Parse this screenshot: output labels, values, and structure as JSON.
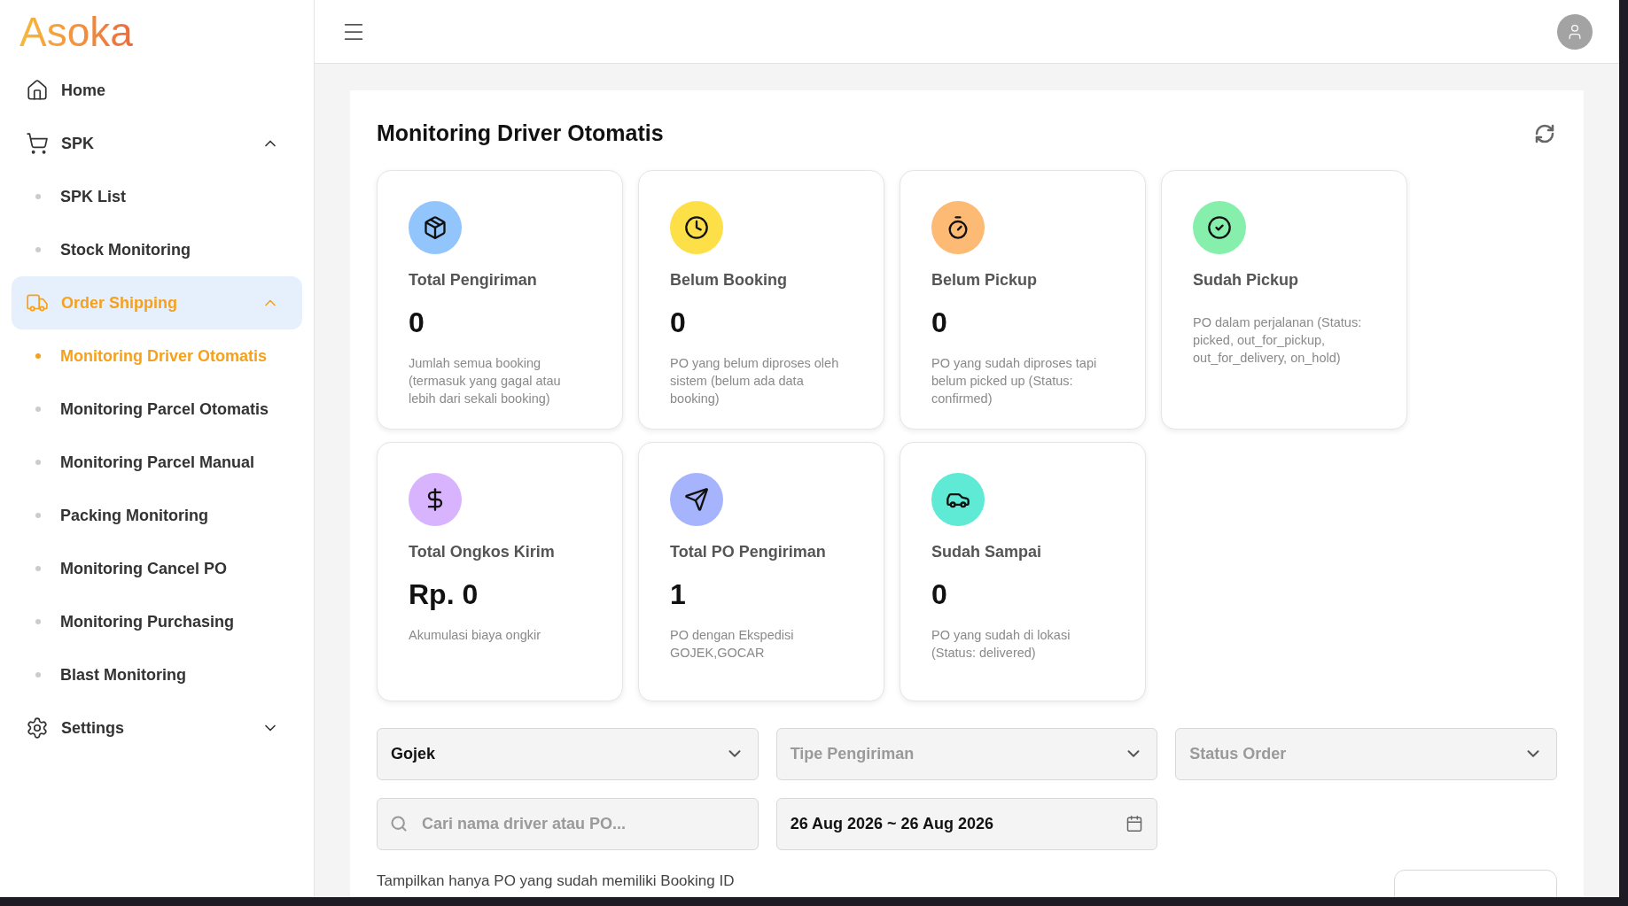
{
  "logo": "Asoka",
  "sidebar": {
    "items": [
      {
        "label": "Home",
        "selected": false
      },
      {
        "label": "SPK",
        "selected": false,
        "expanded": true,
        "children": [
          {
            "label": "SPK List",
            "selected": false
          },
          {
            "label": "Stock Monitoring",
            "selected": false
          }
        ]
      },
      {
        "label": "Order Shipping",
        "selected": true,
        "expanded": true,
        "children": [
          {
            "label": "Monitoring Driver Otomatis",
            "selected": true
          },
          {
            "label": "Monitoring Parcel Otomatis",
            "selected": false
          },
          {
            "label": "Monitoring Parcel Manual",
            "selected": false
          },
          {
            "label": "Packing Monitoring",
            "selected": false
          },
          {
            "label": "Monitoring Cancel PO",
            "selected": false
          },
          {
            "label": "Monitoring Purchasing",
            "selected": false
          },
          {
            "label": "Blast Monitoring",
            "selected": false
          }
        ]
      },
      {
        "label": "Settings",
        "selected": false,
        "expanded": false
      }
    ]
  },
  "page": {
    "title": "Monitoring Driver Otomatis",
    "stats": [
      {
        "color": "#93c5fd",
        "title": "Total Pengiriman",
        "value": "0",
        "description": "Jumlah semua booking (termasuk yang gagal atau lebih dari sekali booking)"
      },
      {
        "color": "#fde047",
        "title": "Belum Booking",
        "value": "0",
        "description": "PO yang belum diproses oleh sistem (belum ada data booking)"
      },
      {
        "color": "#fdba74",
        "title": "Belum Pickup",
        "value": "0",
        "description": "PO yang sudah diproses tapi belum picked up (Status: confirmed)"
      },
      {
        "color": "#86efac",
        "title": "Sudah Pickup",
        "description": "PO dalam perjalanan (Status: picked, out_for_pickup, out_for_delivery, on_hold)"
      },
      {
        "color": "#d8b4fe",
        "title": "Total Ongkos Kirim",
        "value": "Rp. 0",
        "description": "Akumulasi biaya ongkir"
      },
      {
        "color": "#a5b4fc",
        "title": "Total PO Pengiriman",
        "value": "1",
        "description": "PO dengan Ekspedisi GOJEK,GOCAR"
      },
      {
        "color": "#5eead4",
        "title": "Sudah Sampai",
        "value": "0",
        "description": "PO yang sudah di lokasi (Status: delivered)"
      }
    ],
    "filters": [
      {
        "value": "Gojek"
      },
      {
        "placeholder": "Tipe Pengiriman"
      },
      {
        "placeholder": "Status Order"
      }
    ],
    "search": {
      "placeholder": "Cari nama driver atau PO..."
    },
    "date_range": {
      "value": "26 Aug 2026 ~ 26 Aug 2026"
    },
    "note": "Tampilkan hanya PO yang sudah memiliki Booking ID"
  }
}
